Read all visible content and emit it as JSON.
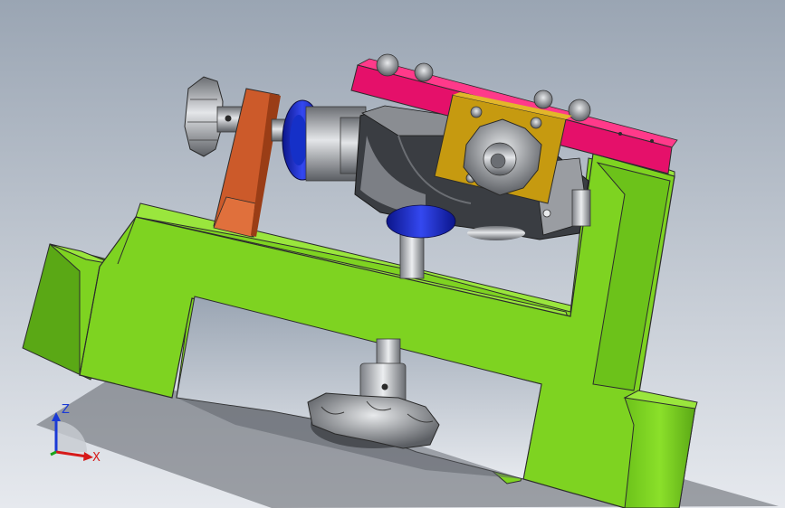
{
  "viewport": {
    "background_top": "#9aa5b3",
    "background_bottom": "#e6e9ee"
  },
  "model": {
    "colors": {
      "base": "#7ed321",
      "base_shade": "#5aa815",
      "base_dark": "#3f7a0a",
      "top_plate": "#e5106a",
      "top_plate_shade": "#b30d52",
      "clamp_block": "#cc5a2a",
      "clamp_block_shade": "#9a3d16",
      "yellow_plate": "#c69a10",
      "yellow_plate_shade": "#8a6a08",
      "blue_ring": "#1f2fd6",
      "blue_ring_shade": "#0b158a",
      "metal_light": "#d8dadd",
      "metal_mid": "#9a9da2",
      "metal_dark": "#4a4d52",
      "body_dark": "#3a3d42",
      "body_mid": "#6b6e73"
    }
  },
  "triad": {
    "z_label": "Z",
    "x_label": "X",
    "z_color": "#1a3ad6",
    "x_color": "#d61a1a",
    "y_color": "#1aa31a"
  }
}
